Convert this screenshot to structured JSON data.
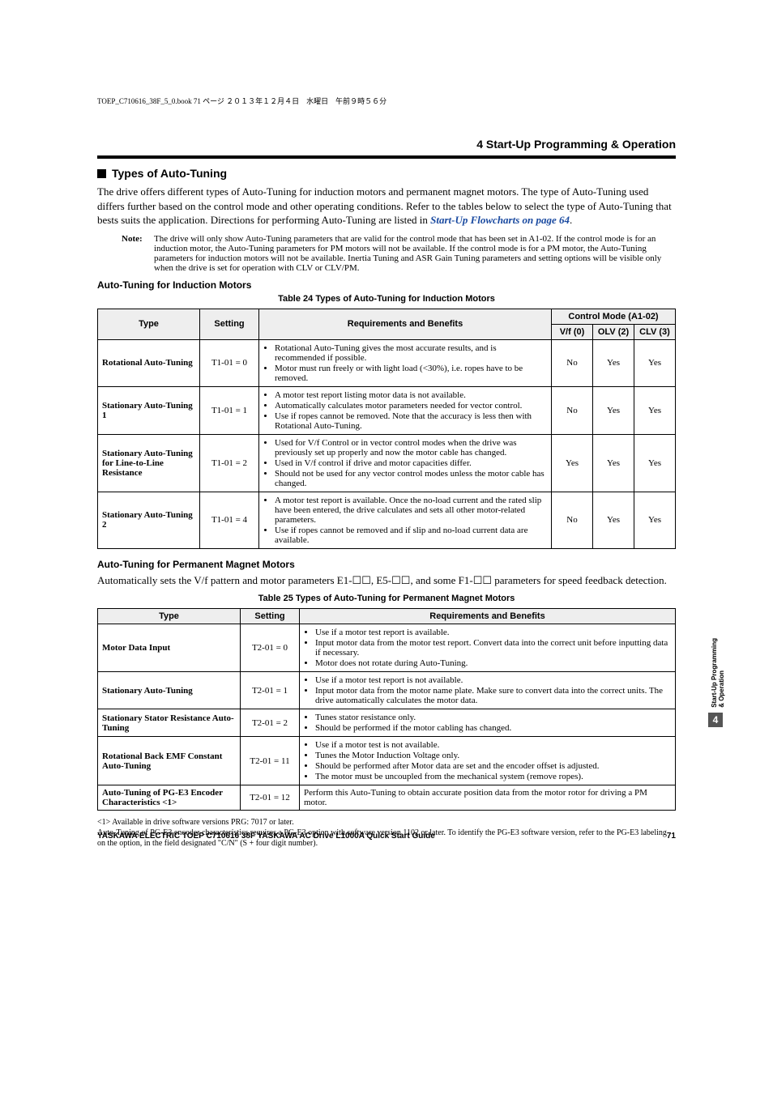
{
  "headerLine": "TOEP_C710616_38F_5_0.book  71 ページ  ２０１３年１２月４日　水曜日　午前９時５６分",
  "sectionHeader": "4  Start-Up Programming & Operation",
  "types": {
    "title": "Types of Auto-Tuning",
    "intro": "The drive offers different types of Auto-Tuning for induction motors and permanent magnet motors. The type of Auto-Tuning used differs further based on the control mode and other operating conditions. Refer to the tables below to select the type of Auto-Tuning that bests suits the application. Directions for performing Auto-Tuning are listed in ",
    "introLink": "Start-Up Flowcharts on page 64",
    "introEnd": ".",
    "noteLabel": "Note:",
    "noteText": "The drive will only show Auto-Tuning parameters that are valid for the control mode that has been set in A1-02. If the control mode is for an induction motor, the Auto-Tuning parameters for PM motors will not be available. If the control mode is for a PM motor, the Auto-Tuning parameters for induction motors will not be available. Inertia Tuning and ASR Gain Tuning parameters and setting options will be visible only when the drive is set for operation with CLV or CLV/PM."
  },
  "induction": {
    "heading": "Auto-Tuning for Induction Motors",
    "tableCaption": "Table 24  Types of Auto-Tuning for Induction Motors",
    "cols": {
      "c1": "Type",
      "c2": "Setting",
      "c3": "Requirements and Benefits",
      "c4": "Control Mode (A1-02)",
      "c4a": "V/f (0)",
      "c4b": "OLV (2)",
      "c4c": "CLV (3)"
    },
    "rows": [
      {
        "type": "Rotational Auto-Tuning",
        "setting": "T1-01 = 0",
        "req": [
          "Rotational Auto-Tuning gives the most accurate results, and is recommended if possible.",
          "Motor must run freely or with light load (<30%), i.e. ropes have to be removed."
        ],
        "vf": "No",
        "olv": "Yes",
        "clv": "Yes"
      },
      {
        "type": "Stationary Auto-Tuning 1",
        "setting": "T1-01 = 1",
        "req": [
          "A motor test report listing motor data is not available.",
          "Automatically calculates motor parameters needed for vector control.",
          "Use if ropes cannot be removed. Note that the accuracy is less then with Rotational Auto-Tuning."
        ],
        "vf": "No",
        "olv": "Yes",
        "clv": "Yes"
      },
      {
        "type": "Stationary Auto-Tuning for Line-to-Line Resistance",
        "setting": "T1-01 = 2",
        "req": [
          "Used for V/f Control or in vector control modes when the drive was previously set up properly and now the motor cable has changed.",
          "Used in V/f control if drive and motor capacities differ.",
          "Should not be used for any vector control modes unless the motor cable has changed."
        ],
        "vf": "Yes",
        "olv": "Yes",
        "clv": "Yes"
      },
      {
        "type": "Stationary Auto-Tuning 2",
        "setting": "T1-01 = 4",
        "req": [
          "A motor test report is available. Once the no-load current and the rated slip have been entered, the drive calculates and sets all other motor-related parameters.",
          "Use if ropes cannot be removed and if slip and no-load current data are available."
        ],
        "vf": "No",
        "olv": "Yes",
        "clv": "Yes"
      }
    ]
  },
  "pm": {
    "heading": "Auto-Tuning for Permanent Magnet Motors",
    "intro": "Automatically sets the V/f pattern and motor parameters E1-☐☐, E5-☐☐, and some F1-☐☐ parameters for speed feedback detection.",
    "tableCaption": "Table 25  Types of Auto-Tuning for Permanent Magnet Motors",
    "cols": {
      "c1": "Type",
      "c2": "Setting",
      "c3": "Requirements and Benefits"
    },
    "rows": [
      {
        "type": "Motor Data Input",
        "setting": "T2-01 = 0",
        "req": [
          "Use if a motor test report is available.",
          "Input motor data from the motor test report. Convert data into the correct unit before inputting data if necessary.",
          "Motor does not rotate during Auto-Tuning."
        ]
      },
      {
        "type": "Stationary Auto-Tuning",
        "setting": "T2-01 = 1",
        "req": [
          "Use if a motor test report is not available.",
          "Input motor data from the motor name plate. Make sure to convert data into the correct units. The drive automatically calculates the motor data."
        ]
      },
      {
        "type": "Stationary Stator Resistance Auto-Tuning",
        "setting": "T2-01 = 2",
        "req": [
          "Tunes stator resistance only.",
          "Should be performed if the motor cabling has changed."
        ]
      },
      {
        "type": "Rotational Back EMF Constant Auto-Tuning",
        "setting": "T2-01 = 11",
        "req": [
          "Use if a motor test is not available.",
          "Tunes the Motor Induction Voltage only.",
          "Should be performed after Motor data are set and the encoder offset is adjusted.",
          "The motor must be uncoupled from the mechanical system (remove ropes)."
        ]
      },
      {
        "type": "Auto-Tuning of PG-E3 Encoder Characteristics <1>",
        "setting": "T2-01 = 12",
        "single": "Perform this Auto-Tuning to obtain accurate position data from the motor rotor for driving a PM motor."
      }
    ]
  },
  "footnote": "<1> Available in drive software versions PRG: 7017 or later.\nAuto-Tuning of PG-E3 encoder characteristics requires a PG-E3 option with software version 1102 or later. To identify the PG-E3 software version, refer to the PG-E3 labeling on the option, in the field designated \"C/N\" (S + four digit number).",
  "sidebarText": "Start-Up Programming\n& Operation",
  "sidebarNum": "4",
  "footer": {
    "left": "YASKAWA ELECTRIC  TOEP C710616 38F YASKAWA AC Drive L1000A Quick Start Guide",
    "right": "71"
  }
}
